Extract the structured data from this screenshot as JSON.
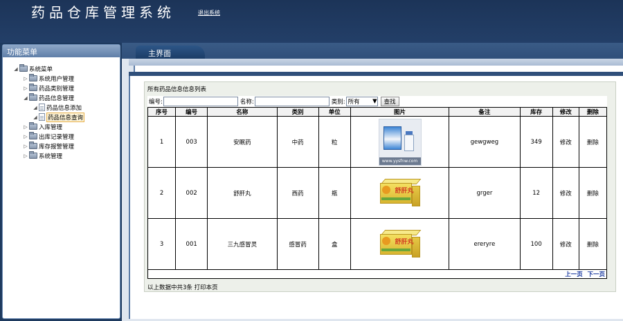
{
  "header": {
    "title": "药品仓库管理系统",
    "logout": "退出系统"
  },
  "sidebar": {
    "title": "功能菜单",
    "items": [
      {
        "label": "系统菜单",
        "level": 0,
        "type": "folder",
        "expanded": true
      },
      {
        "label": "系统用户管理",
        "level": 1,
        "type": "folder"
      },
      {
        "label": "药品类别管理",
        "level": 1,
        "type": "folder"
      },
      {
        "label": "药品信息管理",
        "level": 1,
        "type": "folder",
        "expanded": true
      },
      {
        "label": "药品信息添加",
        "level": 2,
        "type": "page"
      },
      {
        "label": "药品信息查询",
        "level": 2,
        "type": "page",
        "selected": true
      },
      {
        "label": "入库管理",
        "level": 1,
        "type": "folder"
      },
      {
        "label": "出库记录管理",
        "level": 1,
        "type": "folder"
      },
      {
        "label": "库存报警管理",
        "level": 1,
        "type": "folder"
      },
      {
        "label": "系统管理",
        "level": 1,
        "type": "folder"
      }
    ]
  },
  "main": {
    "tab": "主界面",
    "panel_title": "所有药品信息信息列表",
    "search": {
      "code_label": "编号:",
      "name_label": "名称:",
      "category_label": "类别:",
      "category_value": "所有",
      "button": "查找"
    },
    "columns": [
      "序号",
      "编号",
      "名称",
      "类别",
      "单位",
      "图片",
      "备注",
      "库存",
      "修改",
      "删除"
    ],
    "rows": [
      {
        "idx": "1",
        "code": "003",
        "name": "安眠药",
        "category": "中药",
        "unit": "粒",
        "note": "gewgweg",
        "stock": "349",
        "edit": "修改",
        "del": "删除",
        "img_caption": "www.yysfnw.com"
      },
      {
        "idx": "2",
        "code": "002",
        "name": "舒肝丸",
        "category": "西药",
        "unit": "瓶",
        "note": "grger",
        "stock": "12",
        "edit": "修改",
        "del": "删除",
        "img_caption": "舒肝丸"
      },
      {
        "idx": "3",
        "code": "001",
        "name": "三九感冒灵",
        "category": "感冒药",
        "unit": "盒",
        "note": "ereryre",
        "stock": "100",
        "edit": "修改",
        "del": "删除",
        "img_caption": "舒肝丸"
      }
    ],
    "pager": {
      "prev": "上一页",
      "next": "下一页"
    },
    "footer": "以上数据中共3条 打印本页"
  }
}
